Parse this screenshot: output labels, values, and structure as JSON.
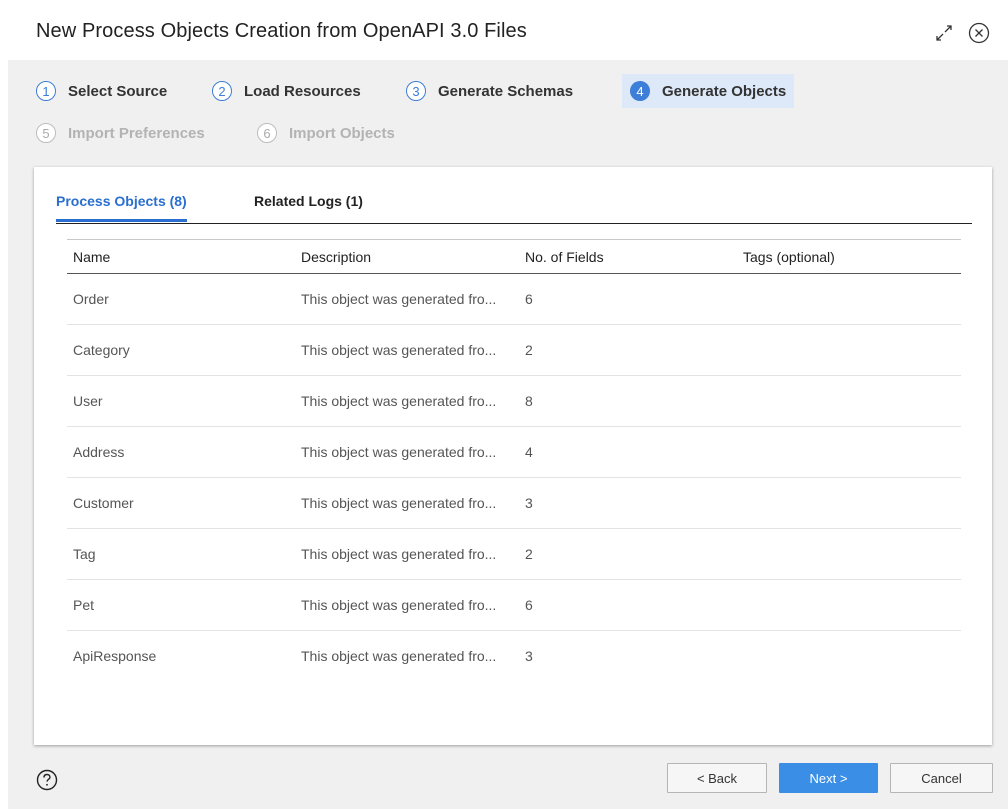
{
  "dialog": {
    "title": "New Process Objects Creation from OpenAPI 3.0 Files",
    "expand_icon": "expand-diagonal-arrows",
    "close_icon": "circle-x"
  },
  "steps": [
    {
      "num": "1",
      "label": "Select Source",
      "state": "done"
    },
    {
      "num": "2",
      "label": "Load Resources",
      "state": "done"
    },
    {
      "num": "3",
      "label": "Generate Schemas",
      "state": "done"
    },
    {
      "num": "4",
      "label": "Generate Objects",
      "state": "active"
    },
    {
      "num": "5",
      "label": "Import Preferences",
      "state": "disabled"
    },
    {
      "num": "6",
      "label": "Import Objects",
      "state": "disabled"
    }
  ],
  "tabs": [
    {
      "label": "Process Objects (8)",
      "active": true
    },
    {
      "label": "Related Logs (1)",
      "active": false
    }
  ],
  "table": {
    "columns": [
      "Name",
      "Description",
      "No. of Fields",
      "Tags (optional)"
    ],
    "rows": [
      {
        "name": "Order",
        "description": "This object was generated fro...",
        "fields": "6",
        "tags": ""
      },
      {
        "name": "Category",
        "description": "This object was generated fro...",
        "fields": "2",
        "tags": ""
      },
      {
        "name": "User",
        "description": "This object was generated fro...",
        "fields": "8",
        "tags": ""
      },
      {
        "name": "Address",
        "description": "This object was generated fro...",
        "fields": "4",
        "tags": ""
      },
      {
        "name": "Customer",
        "description": "This object was generated fro...",
        "fields": "3",
        "tags": ""
      },
      {
        "name": "Tag",
        "description": "This object was generated fro...",
        "fields": "2",
        "tags": ""
      },
      {
        "name": "Pet",
        "description": "This object was generated fro...",
        "fields": "6",
        "tags": ""
      },
      {
        "name": "ApiResponse",
        "description": "This object was generated fro...",
        "fields": "3",
        "tags": ""
      }
    ]
  },
  "footer": {
    "help_icon": "question-circle",
    "back_label": "< Back",
    "next_label": "Next >",
    "cancel_label": "Cancel"
  },
  "colors": {
    "accent": "#2a6fd0",
    "next_button": "#3a8ee6",
    "active_step_bg": "#dde9f8",
    "body_bg": "#f0f0f0"
  }
}
